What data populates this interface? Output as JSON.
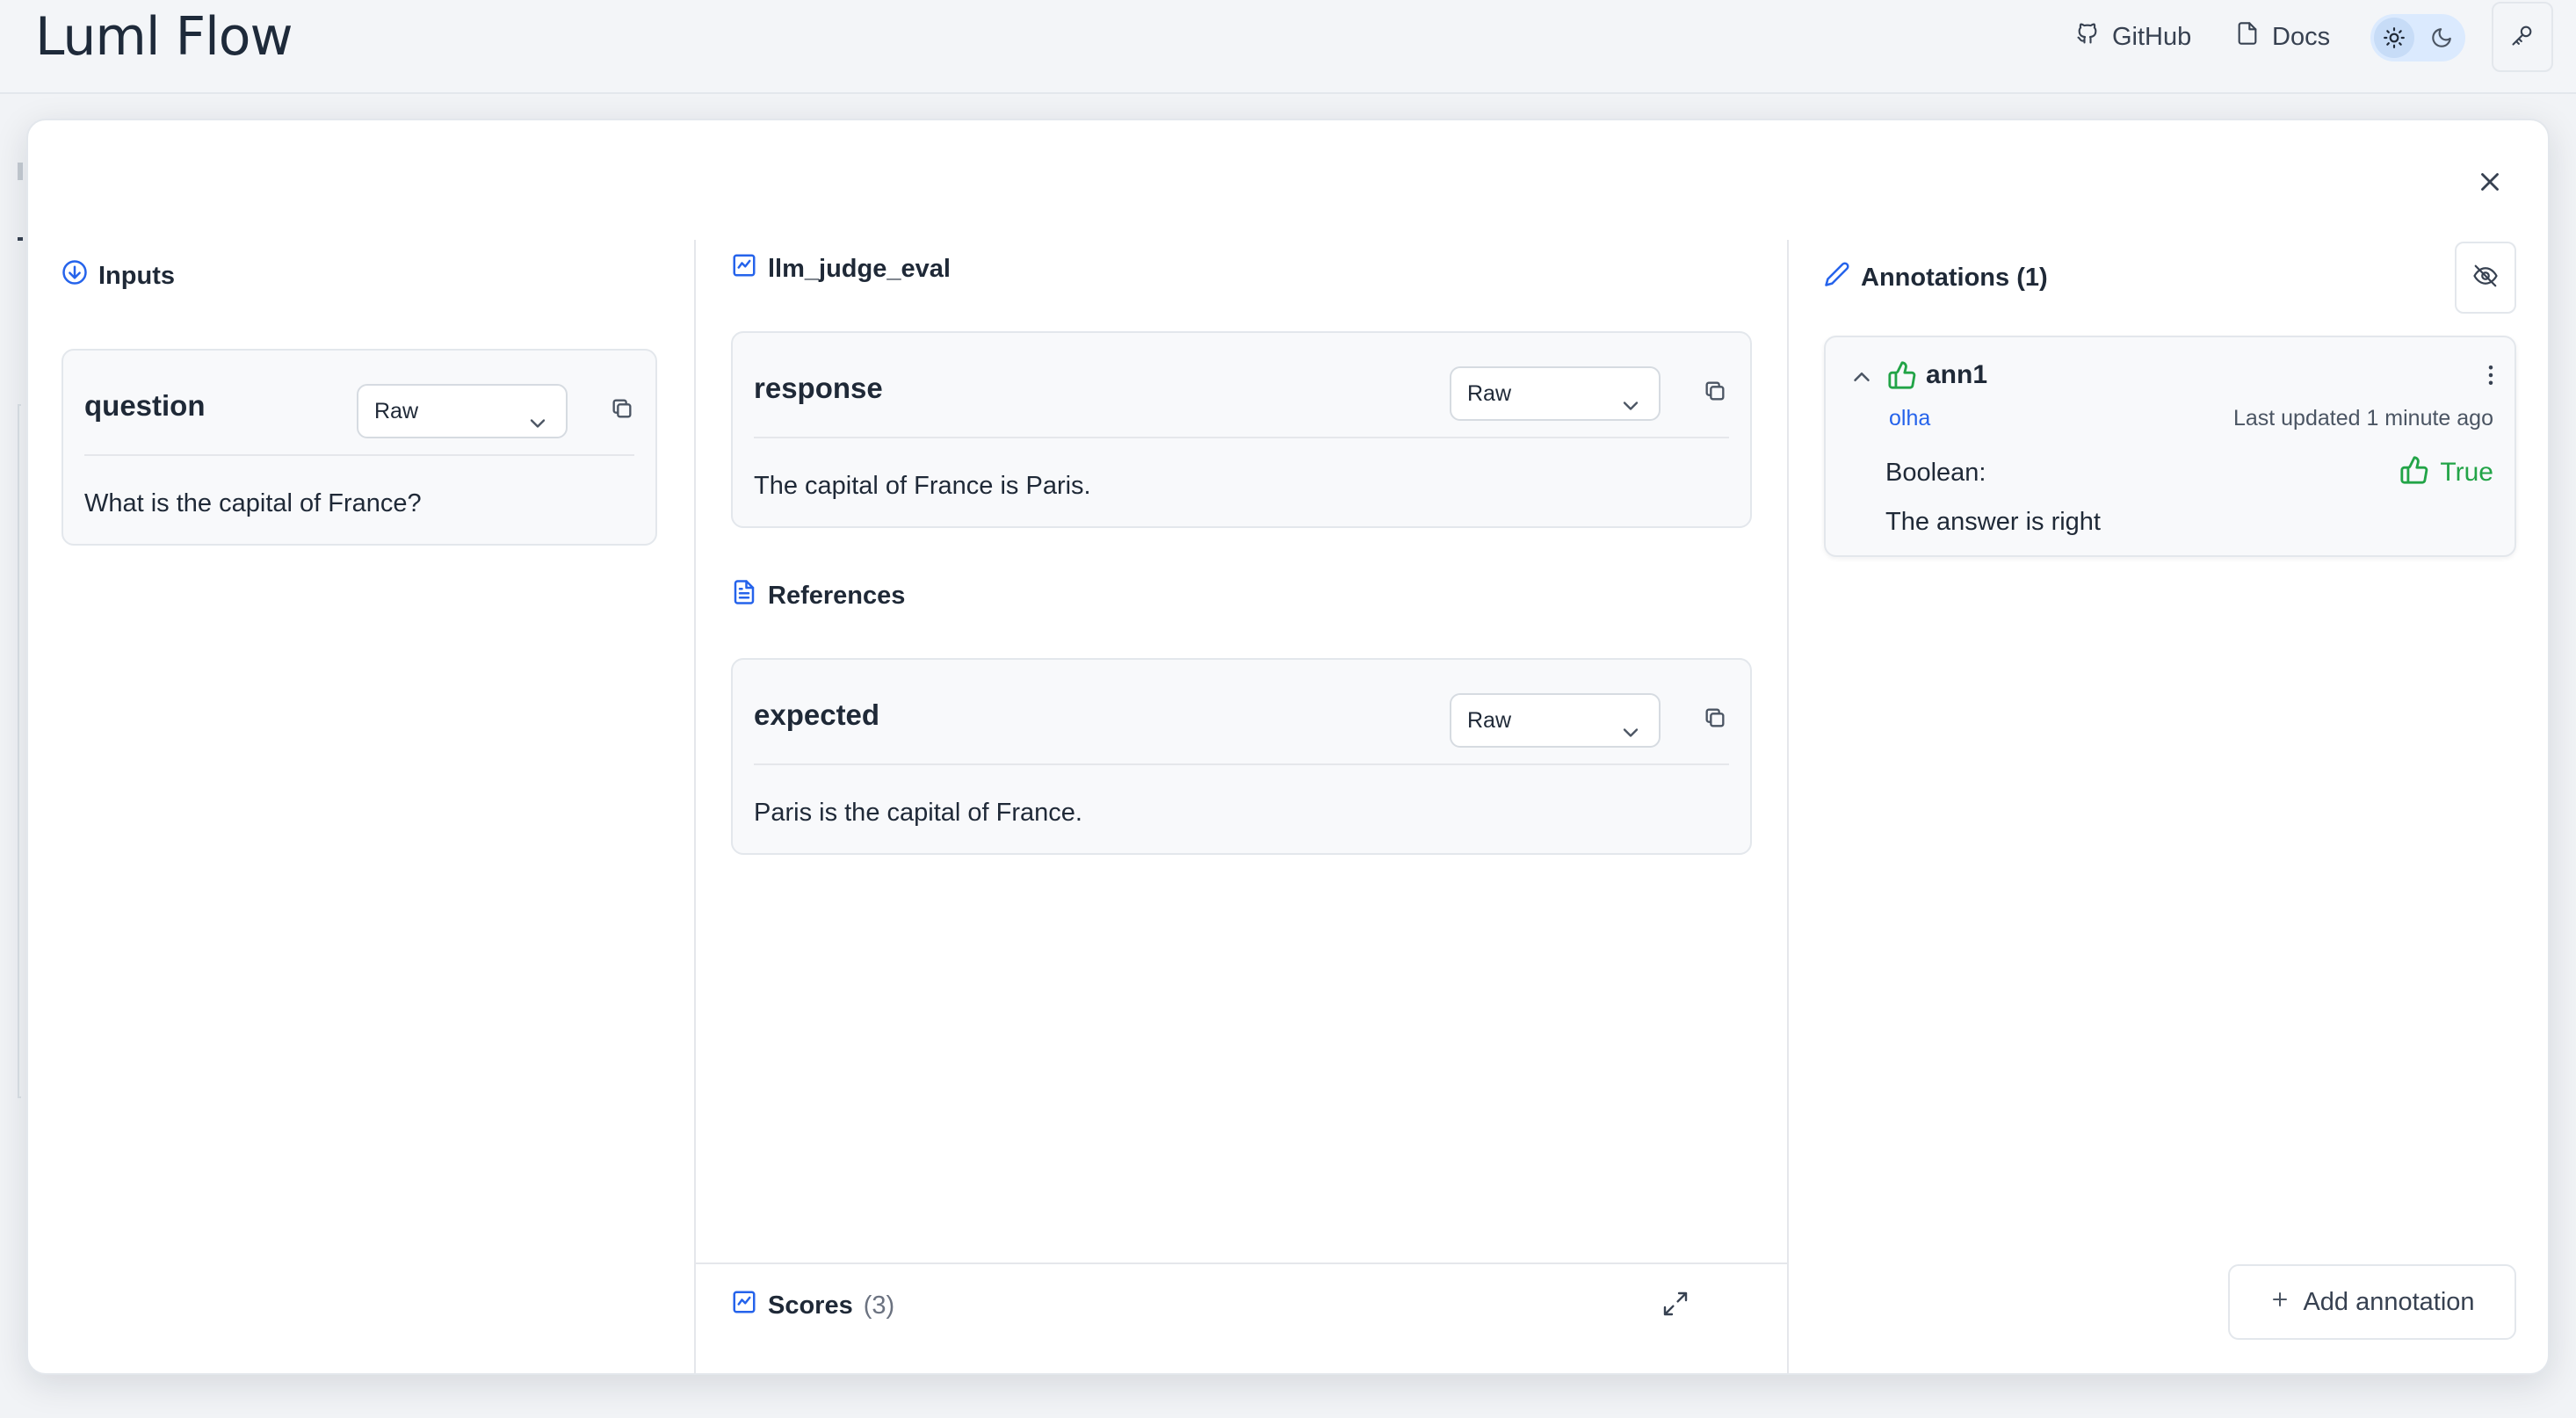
{
  "app": {
    "logo": "Luml Flow"
  },
  "topbar": {
    "github_label": "GitHub",
    "docs_label": "Docs"
  },
  "inputs": {
    "title": "Inputs",
    "fields": [
      {
        "name": "question",
        "format": "Raw",
        "value": "What is the capital of France?"
      }
    ]
  },
  "middle": {
    "title": "llm_judge_eval",
    "outputs": [
      {
        "name": "response",
        "format": "Raw",
        "value": "The capital of France is Paris."
      }
    ],
    "references_title": "References",
    "references": [
      {
        "name": "expected",
        "format": "Raw",
        "value": "Paris is the capital of France."
      }
    ],
    "scores_label": "Scores",
    "scores_count": "(3)"
  },
  "annotations": {
    "title": "Annotations (1)",
    "items": [
      {
        "name": "ann1",
        "user": "olha",
        "updated": "Last updated 1 minute ago",
        "type_label": "Boolean:",
        "value": "True",
        "note": "The answer is right"
      }
    ],
    "add_label": "Add annotation"
  },
  "colors": {
    "accent": "#2563eb",
    "positive": "#22a447",
    "border": "#e3e7ec"
  },
  "icons": [
    "github-icon",
    "docs-icon",
    "sun-icon",
    "moon-icon",
    "key-icon",
    "close-icon",
    "arrow-down-circle-icon",
    "flow-icon",
    "file-icon",
    "chevron-down-icon",
    "copy-icon",
    "expand-icon",
    "pencil-icon",
    "eye-off-icon",
    "chevron-up-icon",
    "thumbs-up-icon",
    "more-vertical-icon",
    "plus-icon"
  ]
}
